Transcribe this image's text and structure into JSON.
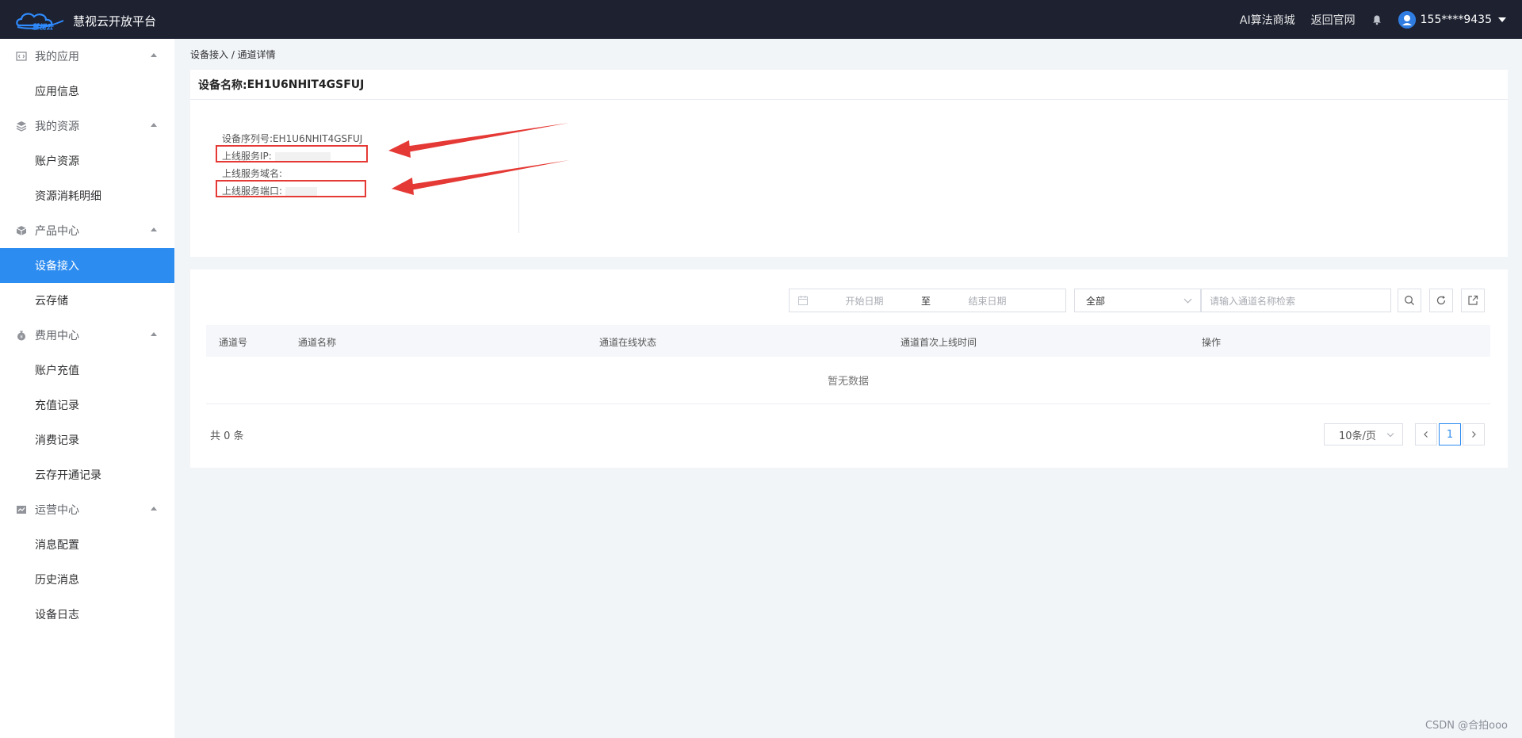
{
  "header": {
    "logo_text": "慧视云",
    "app_title": "慧视云开放平台",
    "links": [
      "AI算法商城",
      "返回官网"
    ],
    "user": "155****9435"
  },
  "sidebar": {
    "groups": [
      {
        "label": "我的应用",
        "icon": "code-icon",
        "items": [
          "应用信息"
        ]
      },
      {
        "label": "我的资源",
        "icon": "layers-icon",
        "items": [
          "账户资源",
          "资源消耗明细"
        ]
      },
      {
        "label": "产品中心",
        "icon": "cube-icon",
        "items": [
          "设备接入",
          "云存储"
        ]
      },
      {
        "label": "费用中心",
        "icon": "money-bag-icon",
        "items": [
          "账户充值",
          "充值记录",
          "消费记录",
          "云存开通记录"
        ]
      },
      {
        "label": "运营中心",
        "icon": "chart-icon",
        "items": [
          "消息配置",
          "历史消息",
          "设备日志"
        ]
      }
    ],
    "active_item": "设备接入"
  },
  "breadcrumb": "设备接入 / 通道详情",
  "device": {
    "name_label": "设备名称:",
    "name_value": "EH1U6NHIT4GSFUJ",
    "serial_label": "设备序列号:",
    "serial_value": "EH1U6NHIT4GSFUJ",
    "ip_label": "上线服务IP:",
    "domain_label": "上线服务域名:",
    "port_label": "上线服务端口:"
  },
  "filters": {
    "start_placeholder": "开始日期",
    "range_separator": "至",
    "end_placeholder": "结束日期",
    "status_selected": "全部",
    "search_placeholder": "请输入通道名称检索"
  },
  "table": {
    "columns": [
      "通道号",
      "通道名称",
      "通道在线状态",
      "通道首次上线时间",
      "操作"
    ],
    "empty_text": "暂无数据"
  },
  "pagination": {
    "total_text": "共 0 条",
    "page_size": "10条/页",
    "current_page": "1"
  },
  "watermark": "CSDN @合拍ooo",
  "colors": {
    "topbar": "#1d2130",
    "accent": "#2d8cf0",
    "highlight": "#e53935"
  }
}
